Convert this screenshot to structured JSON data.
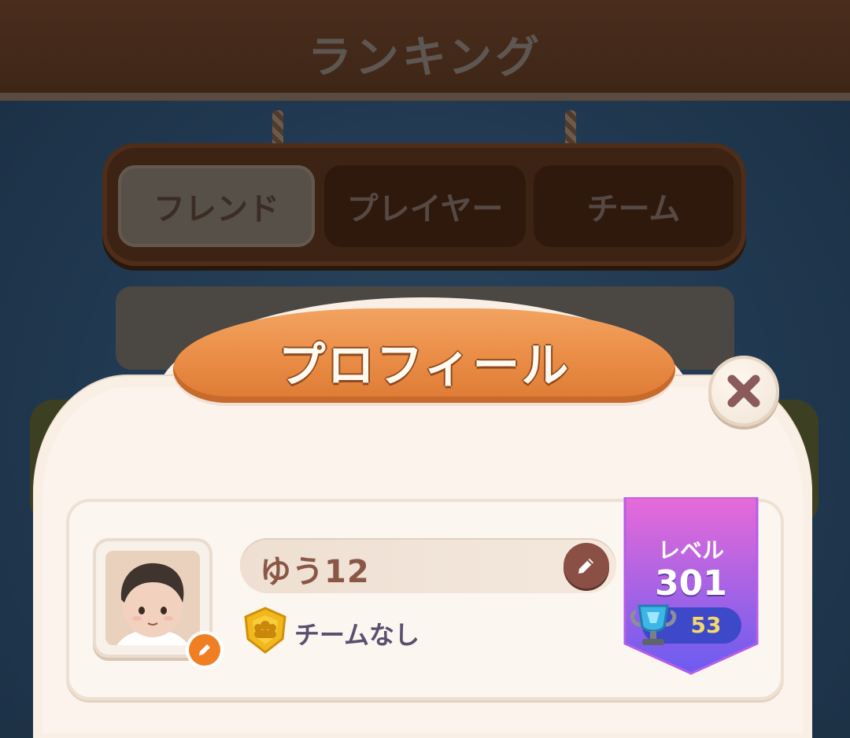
{
  "background": {
    "title": "ランキング",
    "tabs": [
      {
        "label": "フレンド",
        "active": true
      },
      {
        "label": "プレイヤー",
        "active": false
      },
      {
        "label": "チーム",
        "active": false
      }
    ]
  },
  "modal": {
    "title": "プロフィール",
    "close_icon": "close-x-icon"
  },
  "profile": {
    "name": "ゆう12",
    "team_status": "チームなし",
    "level_label": "レベル",
    "level": "301",
    "trophies": "53"
  },
  "colors": {
    "title_plate": "#e98c45",
    "level_ribbon_top": "#e86ad8",
    "level_ribbon_bottom": "#6a5cf0",
    "close_x": "#8b5a5a"
  }
}
